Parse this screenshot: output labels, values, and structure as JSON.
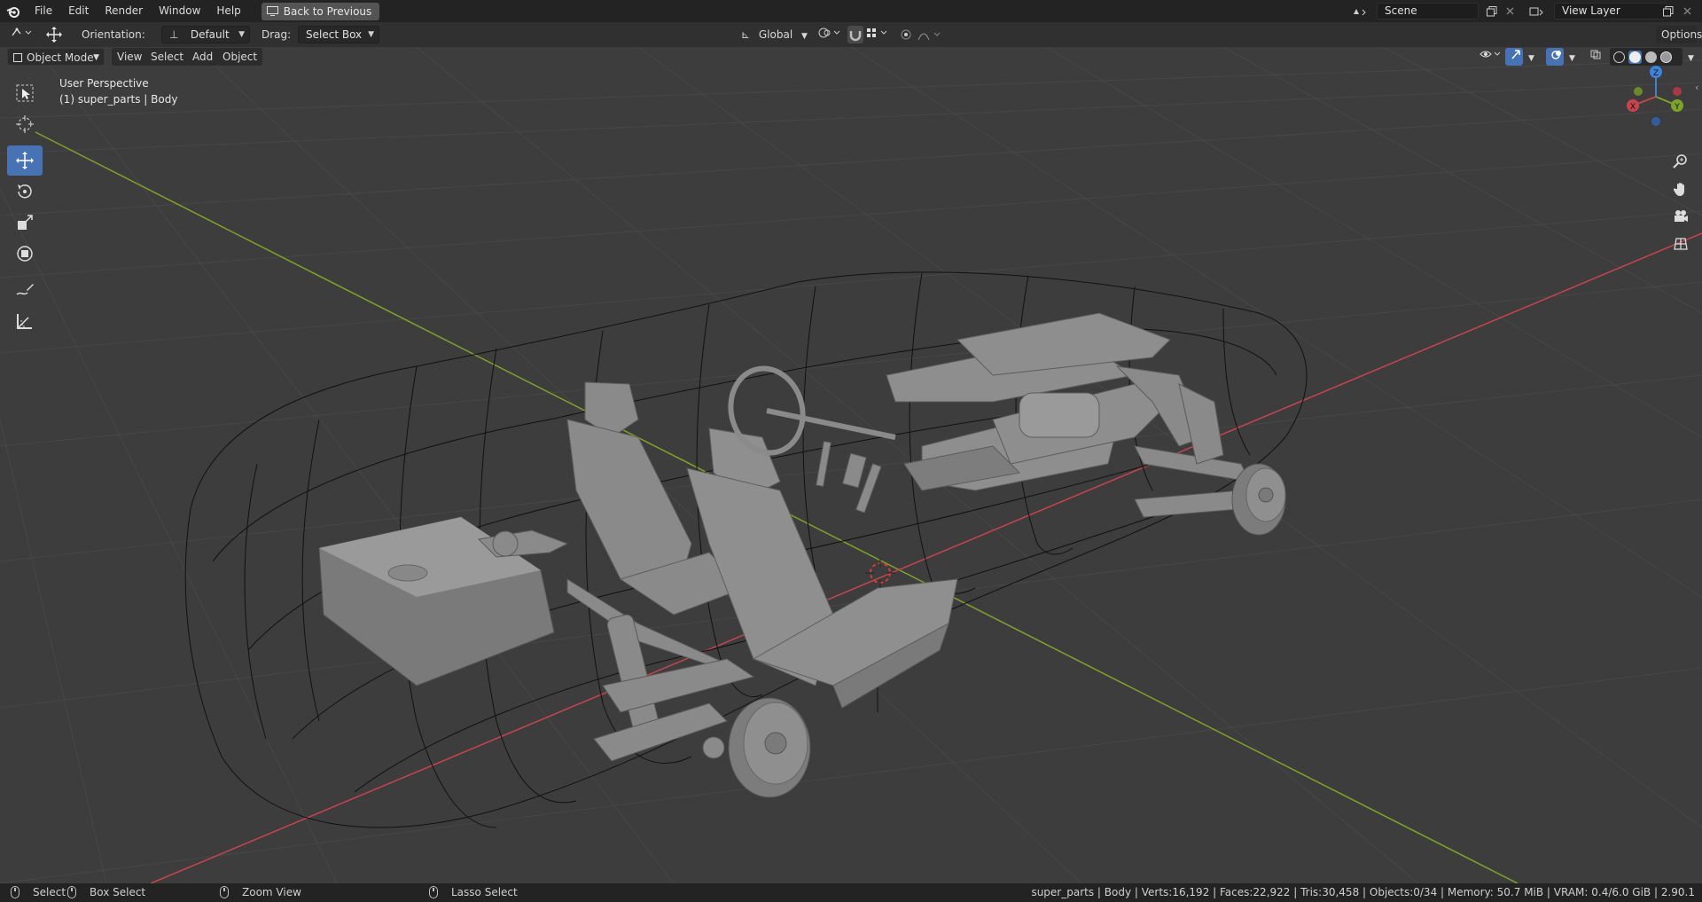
{
  "menu": {
    "items": [
      "File",
      "Edit",
      "Render",
      "Window",
      "Help"
    ],
    "back_button": "Back to Previous"
  },
  "scene": {
    "name": "Scene"
  },
  "view_layer": {
    "name": "View Layer"
  },
  "tool_header": {
    "orientation_label": "Orientation:",
    "orientation_value": "Default",
    "drag_label": "Drag:",
    "drag_value": "Select Box",
    "transform_orientation": "Global",
    "options_label": "Options"
  },
  "viewport_header": {
    "mode": "Object Mode",
    "menus": [
      "View",
      "Select",
      "Add",
      "Object"
    ]
  },
  "viewport": {
    "perspective_label": "User Perspective",
    "object_label": "(1) super_parts | Body"
  },
  "toolbar": {
    "tools": [
      "select-box",
      "cursor",
      "move",
      "rotate",
      "scale",
      "transform",
      "annotate",
      "measure"
    ],
    "active": "move"
  },
  "gizmo": {
    "x": "X",
    "y": "Y",
    "z": "Z"
  },
  "status_bar": {
    "select": "Select",
    "box_select": "Box Select",
    "zoom_view": "Zoom View",
    "lasso_select": "Lasso Select",
    "stats": "super_parts | Body | Verts:16,192 | Faces:22,922 | Tris:30,458 | Objects:0/34 | Memory: 50.7 MiB | VRAM: 0.4/6.0 GiB | 2.90.1"
  },
  "colors": {
    "accent": "#4772b3",
    "x_axis": "#c9434f",
    "y_axis": "#7ea32a",
    "z_axis": "#3f82d9"
  }
}
